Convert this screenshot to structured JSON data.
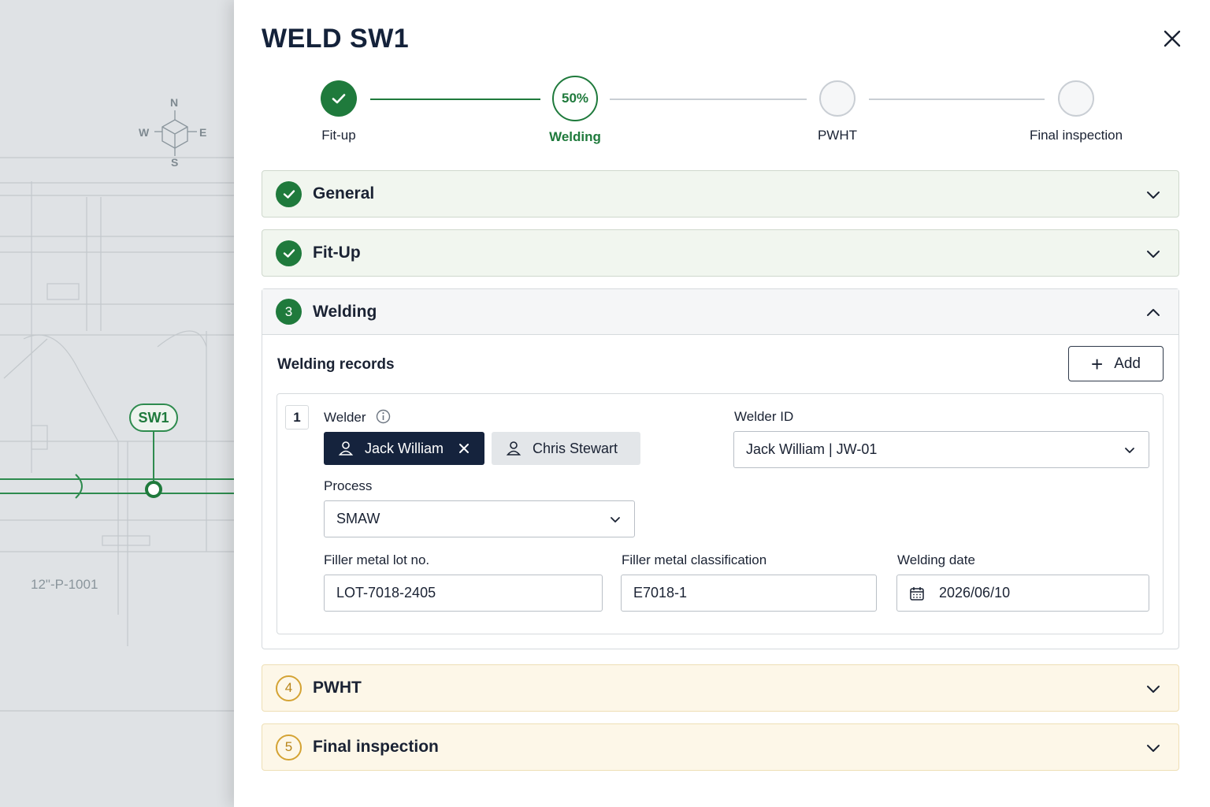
{
  "background": {
    "compass": {
      "n": "N",
      "s": "S",
      "e": "E",
      "w": "W"
    },
    "pipe_label": "12\"-P-1001",
    "weld_tag": "SW1"
  },
  "panel": {
    "title": "WELD SW1",
    "close_icon": "close-icon"
  },
  "stepper": {
    "steps": [
      {
        "label": "Fit-up",
        "state": "done"
      },
      {
        "label": "Welding",
        "state": "active",
        "progress_text": "50%"
      },
      {
        "label": "PWHT",
        "state": "pending"
      },
      {
        "label": "Final inspection",
        "state": "pending"
      }
    ]
  },
  "sections": {
    "general": {
      "title": "General",
      "state": "complete"
    },
    "fitup": {
      "title": "Fit-Up",
      "state": "complete"
    },
    "welding": {
      "number": "3",
      "title": "Welding",
      "state": "open"
    },
    "pwht": {
      "number": "4",
      "title": "PWHT",
      "state": "pending"
    },
    "final": {
      "number": "5",
      "title": "Final inspection",
      "state": "pending"
    }
  },
  "welding": {
    "records_title": "Welding records",
    "add_label": "Add",
    "record": {
      "index": "1",
      "welder_label": "Welder",
      "welders": [
        {
          "name": "Jack William",
          "selected": true
        },
        {
          "name": "Chris Stewart",
          "selected": false
        }
      ],
      "welder_id_label": "Welder ID",
      "welder_id_value": "Jack William | JW-01",
      "process_label": "Process",
      "process_value": "SMAW",
      "filler_lot_label": "Filler metal lot no.",
      "filler_lot_value": "LOT-7018-2405",
      "filler_class_label": "Filler metal classification",
      "filler_class_value": "E7018-1",
      "weld_date_label": "Welding date",
      "weld_date_value": "2026/06/10"
    }
  },
  "colors": {
    "accent_green": "#1f7a3c",
    "pending_amber": "#d4a334",
    "chip_dark": "#15233d"
  }
}
